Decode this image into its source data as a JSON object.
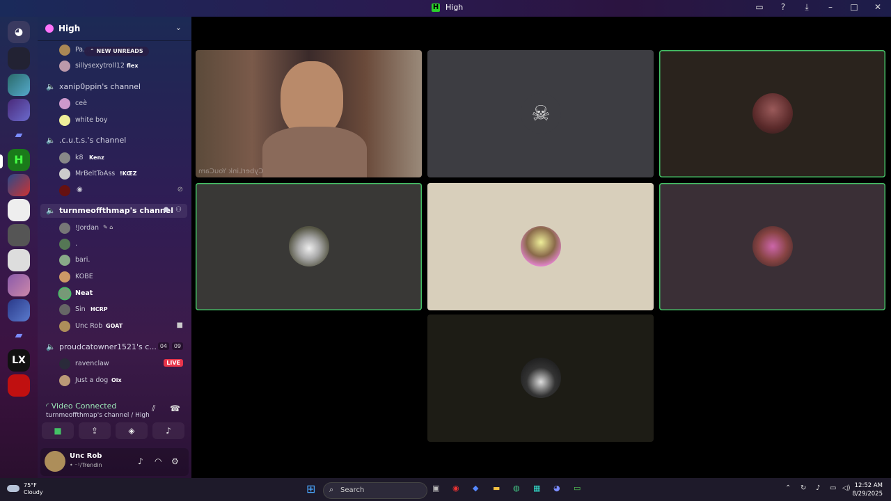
{
  "window": {
    "title": "High"
  },
  "guild": {
    "name": "High"
  },
  "new_unreads": "NEW UNREADS",
  "channels": [
    {
      "name": "Pa…",
      "partial": true
    },
    {
      "name": "xanip0ppin's channel"
    },
    {
      "name": ".c.u.t.s.'s channel"
    },
    {
      "name": "turnmeoffthmap's channel"
    },
    {
      "name": "proudcatowner1521's c...",
      "count_a": "04",
      "count_b": "09"
    }
  ],
  "users": {
    "top": [
      {
        "name": "sillysexytroll12",
        "tag": "flex"
      }
    ],
    "xanip": [
      {
        "name": "ceè"
      },
      {
        "name": "white boy"
      }
    ],
    "cuts": [
      {
        "name": "k8",
        "tag": "Kenz"
      },
      {
        "name": "MrBeltToAss",
        "tag": "!KŒZ"
      }
    ],
    "turnme": [
      {
        "name": "!Jordan"
      },
      {
        "name": "."
      },
      {
        "name": "bari."
      },
      {
        "name": "KOBE"
      },
      {
        "name": "Neat"
      },
      {
        "name": "Sin",
        "tag": "HCRP"
      },
      {
        "name": "Unc Rob",
        "tag": "GOAT"
      }
    ],
    "proud": [
      {
        "name": "ravenclaw",
        "live": "LIVE"
      },
      {
        "name": "Just a dog",
        "tag": "Oix"
      }
    ]
  },
  "voice": {
    "status": "Video Connected",
    "location": "turnmeoffthmap's channel / High"
  },
  "user_panel": {
    "name": "Unc Rob",
    "status": "• ⁻¹/Trendin"
  },
  "video": {
    "watermark": "CyberLink YouCam"
  },
  "taskbar": {
    "weather_temp": "75°F",
    "weather_desc": "Cloudy",
    "search_placeholder": "Search",
    "time": "12:52 AM",
    "date": "8/29/2025"
  },
  "colors": {
    "speaking": "#44c266",
    "live": "#e8344a",
    "connected": "#9be5b6"
  }
}
